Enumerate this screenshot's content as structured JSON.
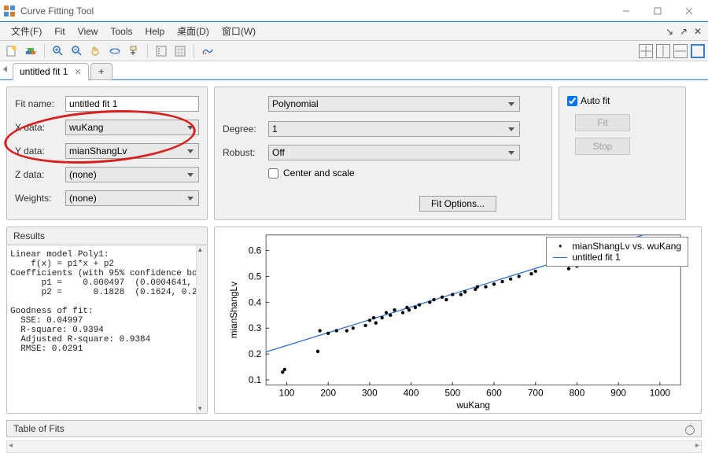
{
  "window": {
    "title": "Curve Fitting Tool"
  },
  "menu": {
    "file": "文件(F)",
    "fit": "Fit",
    "view": "View",
    "tools": "Tools",
    "help": "Help",
    "desktop": "桌面(D)",
    "window": "窗口(W)"
  },
  "tabs": {
    "active": "untitled fit 1"
  },
  "fit_config": {
    "fitname_label": "Fit name:",
    "fitname_value": "untitled fit 1",
    "xdata_label": "X data:",
    "xdata_value": "wuKang",
    "ydata_label": "Y data:",
    "ydata_value": "mianShangLv",
    "zdata_label": "Z data:",
    "zdata_value": "(none)",
    "weights_label": "Weights:",
    "weights_value": "(none)"
  },
  "fit_type": {
    "method": "Polynomial",
    "degree_label": "Degree:",
    "degree_value": "1",
    "robust_label": "Robust:",
    "robust_value": "Off",
    "center_label": "Center and scale",
    "options_btn": "Fit Options..."
  },
  "actions": {
    "autofit_label": "Auto fit",
    "fit_btn": "Fit",
    "stop_btn": "Stop"
  },
  "results": {
    "title": "Results",
    "text": "Linear model Poly1:\n    f(x) = p1*x + p2\nCoefficients (with 95% confidence boun\n      p1 =    0.000497  (0.0004641, 0.\n      p2 =      0.1828  (0.1624, 0.203\n\nGoodness of fit:\n  SSE: 0.04997\n  R-square: 0.9394\n  Adjusted R-square: 0.9384\n  RMSE: 0.0291\n"
  },
  "tof_title": "Table of Fits",
  "chart_data": {
    "type": "scatter+line",
    "xlabel": "wuKang",
    "ylabel": "mianShangLv",
    "xlim": [
      50,
      1050
    ],
    "ylim": [
      0.08,
      0.66
    ],
    "xticks": [
      100,
      200,
      300,
      400,
      500,
      600,
      700,
      800,
      900,
      1000
    ],
    "yticks": [
      0.1,
      0.2,
      0.3,
      0.4,
      0.5,
      0.6
    ],
    "series": [
      {
        "name": "mianShangLv vs. wuKang",
        "type": "scatter",
        "x": [
          90,
          95,
          175,
          180,
          200,
          220,
          245,
          260,
          290,
          300,
          310,
          315,
          330,
          340,
          350,
          360,
          380,
          390,
          395,
          410,
          420,
          445,
          455,
          475,
          485,
          500,
          520,
          530,
          555,
          560,
          580,
          600,
          620,
          640,
          660,
          690,
          700,
          780,
          800,
          1020,
          1030,
          1040
        ],
        "y": [
          0.13,
          0.14,
          0.21,
          0.29,
          0.28,
          0.29,
          0.29,
          0.3,
          0.31,
          0.33,
          0.34,
          0.32,
          0.34,
          0.36,
          0.35,
          0.37,
          0.36,
          0.38,
          0.37,
          0.38,
          0.39,
          0.4,
          0.41,
          0.42,
          0.41,
          0.43,
          0.43,
          0.44,
          0.45,
          0.46,
          0.46,
          0.47,
          0.48,
          0.49,
          0.5,
          0.51,
          0.52,
          0.53,
          0.54,
          0.61,
          0.62,
          0.63
        ]
      },
      {
        "name": "untitled fit 1",
        "type": "line",
        "x": [
          50,
          1050
        ],
        "y": [
          0.208,
          0.705
        ]
      }
    ],
    "legend": [
      "mianShangLv vs. wuKang",
      "untitled fit 1"
    ]
  }
}
